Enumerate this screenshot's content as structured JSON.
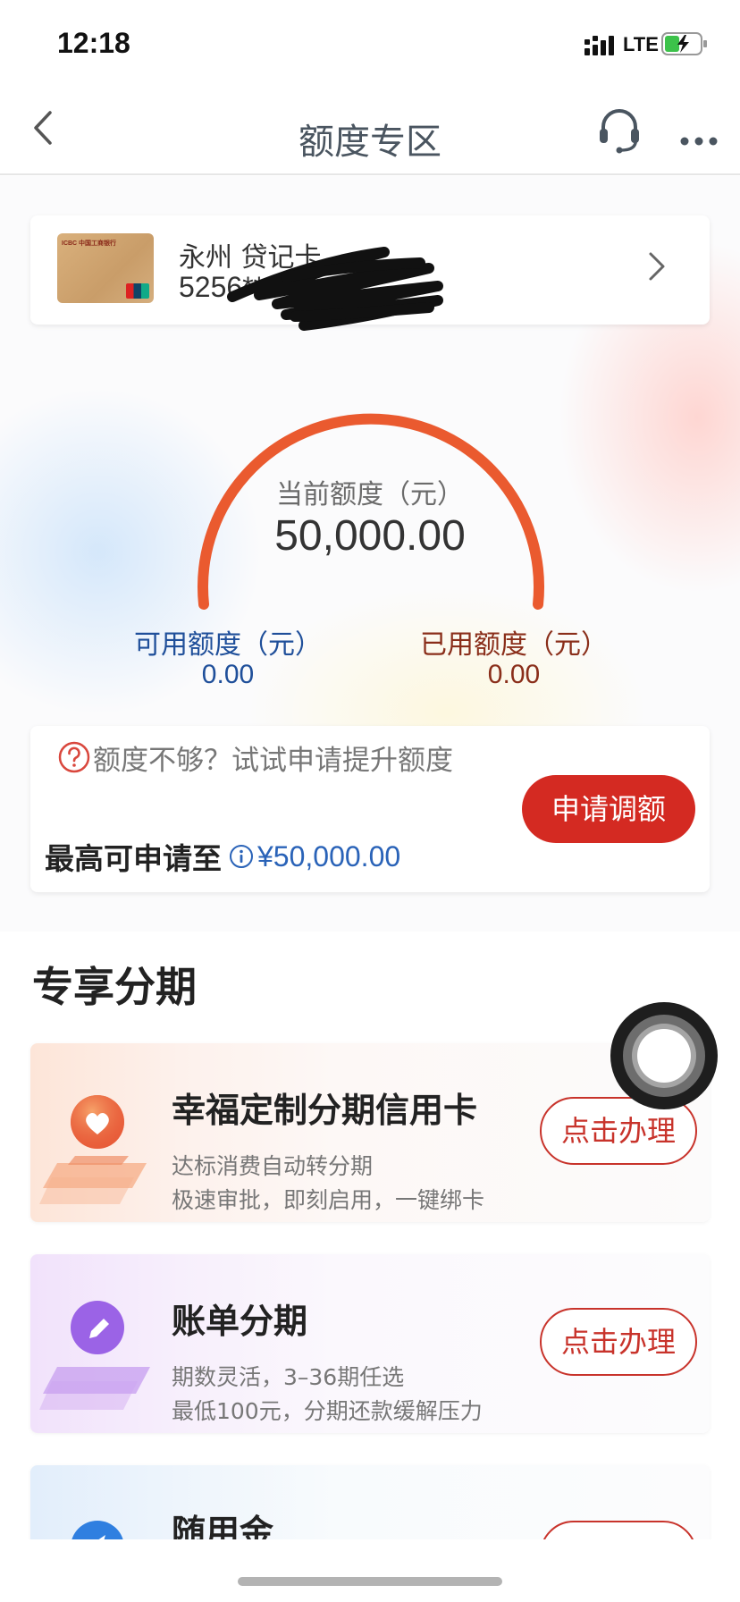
{
  "status_bar": {
    "time": "12:18",
    "network": "LTE"
  },
  "nav": {
    "title": "额度专区",
    "back_icon": "chevron-left-icon",
    "service_icon": "headset-icon",
    "more_icon": "more-dots-icon"
  },
  "card": {
    "name": "永州 贷记卡",
    "number": "5256**",
    "logo_text": "ICBC 中国工商银行"
  },
  "gauge": {
    "label": "当前额度（元）",
    "value": "50,000.00",
    "available_label": "可用额度（元）",
    "available_value": "0.00",
    "used_label": "已用额度（元）",
    "used_value": "0.00",
    "arc_color": "#ea5a2f"
  },
  "apply": {
    "hint": "额度不够？试试申请提升额度",
    "max_label": "最高可申请至",
    "max_value": "¥50,000.00",
    "button": "申请调额",
    "button_color": "#d42a22"
  },
  "section": {
    "title": "专享分期"
  },
  "items": [
    {
      "title": "幸福定制分期信用卡",
      "sub1": "达标消费自动转分期",
      "sub2": "极速审批，即刻启用，一键绑卡",
      "button": "点击办理",
      "icon": "heart-icon"
    },
    {
      "title": "账单分期",
      "sub1": "期数灵活，3–36期任选",
      "sub2": "最低100元，分期还款缓解压力",
      "button": "点击办理",
      "icon": "pen-icon"
    },
    {
      "title": "随用金",
      "sub1": "",
      "sub2": "",
      "button": "",
      "icon": "rocket-icon"
    }
  ]
}
